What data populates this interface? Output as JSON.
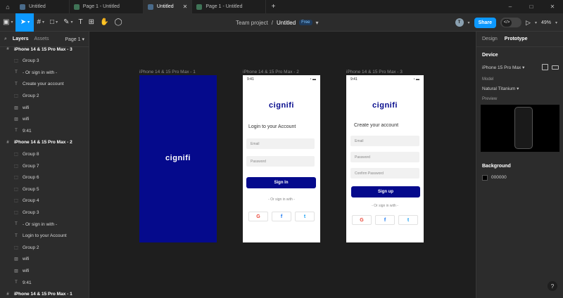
{
  "tabs": [
    {
      "label": "Untitled",
      "active": false
    },
    {
      "label": "Page 1 - Untitled",
      "active": false
    },
    {
      "label": "Untitled",
      "active": true
    },
    {
      "label": "Page 1 - Untitled",
      "active": false
    }
  ],
  "window_controls": {
    "minimize": "–",
    "maximize": "□",
    "close": "✕"
  },
  "toolbar": {
    "project": "Team project",
    "separator": "/",
    "file_name": "Untitled",
    "plan_badge": "Free",
    "avatar_initial": "T",
    "share_label": "Share",
    "dev_mode_icon": "</>",
    "zoom_level": "49%"
  },
  "left_panel": {
    "tab_layers": "Layers",
    "tab_assets": "Assets",
    "page_selector": "Page 1",
    "layers": [
      {
        "label": "iPhone 14 & 15 Pro Max - 3",
        "type": "frame",
        "indent": 0
      },
      {
        "label": "Group 3",
        "type": "group",
        "indent": 1
      },
      {
        "label": "- Or sign in with -",
        "type": "text",
        "indent": 1
      },
      {
        "label": "Create your account",
        "type": "text",
        "indent": 1
      },
      {
        "label": "Group 2",
        "type": "group",
        "indent": 1
      },
      {
        "label": "wifi",
        "type": "image",
        "indent": 1
      },
      {
        "label": "wifi",
        "type": "image",
        "indent": 1
      },
      {
        "label": "9:41",
        "type": "text",
        "indent": 1
      },
      {
        "label": "iPhone 14 & 15 Pro Max - 2",
        "type": "frame",
        "indent": 0
      },
      {
        "label": "Group 8",
        "type": "group",
        "indent": 1
      },
      {
        "label": "Group 7",
        "type": "group",
        "indent": 1
      },
      {
        "label": "Group 6",
        "type": "group",
        "indent": 1
      },
      {
        "label": "Group 5",
        "type": "group",
        "indent": 1
      },
      {
        "label": "Group 4",
        "type": "group",
        "indent": 1
      },
      {
        "label": "Group 3",
        "type": "group",
        "indent": 1
      },
      {
        "label": "- Or sign in with -",
        "type": "text",
        "indent": 1
      },
      {
        "label": "Login to your Account",
        "type": "text",
        "indent": 1
      },
      {
        "label": "Group 2",
        "type": "group",
        "indent": 1
      },
      {
        "label": "wifi",
        "type": "image",
        "indent": 1
      },
      {
        "label": "wifi",
        "type": "image",
        "indent": 1
      },
      {
        "label": "9:41",
        "type": "text",
        "indent": 1
      },
      {
        "label": "iPhone 14 & 15 Pro Max - 1",
        "type": "frame",
        "indent": 0
      }
    ]
  },
  "canvas": {
    "frames": [
      {
        "label": "iPhone 14 & 15 Pro Max - 1"
      },
      {
        "label": "iPhone 14 & 15 Pro Max - 2"
      },
      {
        "label": "iPhone 14 & 15 Pro Max - 3"
      }
    ],
    "splash": {
      "logo": "cignifi"
    },
    "login": {
      "time": "9:41",
      "logo": "cignifi",
      "title": "Login to your Account",
      "email_placeholder": "Email",
      "password_placeholder": "Password",
      "button": "Sign In",
      "or_text": "- Or sign in with -",
      "social": [
        "G",
        "f",
        "t"
      ]
    },
    "signup": {
      "time": "9:41",
      "logo": "cignifi",
      "title": "Create your account",
      "email_placeholder": "Email",
      "password_placeholder": "Password",
      "confirm_placeholder": "Confirm Password",
      "button": "Sign up",
      "or_text": "- Or sign in with -",
      "social": [
        "G",
        "f",
        "t"
      ]
    }
  },
  "right_panel": {
    "tab_design": "Design",
    "tab_prototype": "Prototype",
    "device_heading": "Device",
    "device_value": "iPhone 15 Pro Max",
    "model_label": "Model",
    "model_value": "Natural Titanium",
    "preview_label": "Preview",
    "background_heading": "Background",
    "background_value": "000000",
    "help": "?"
  },
  "colors": {
    "accent": "#0d99ff",
    "brand_blue": "#050a8c",
    "canvas_bg": "#1e1e1e",
    "panel_bg": "#2c2c2c",
    "google_red": "#ea4335",
    "facebook_blue": "#1877f2",
    "twitter_blue": "#1da1f2"
  }
}
